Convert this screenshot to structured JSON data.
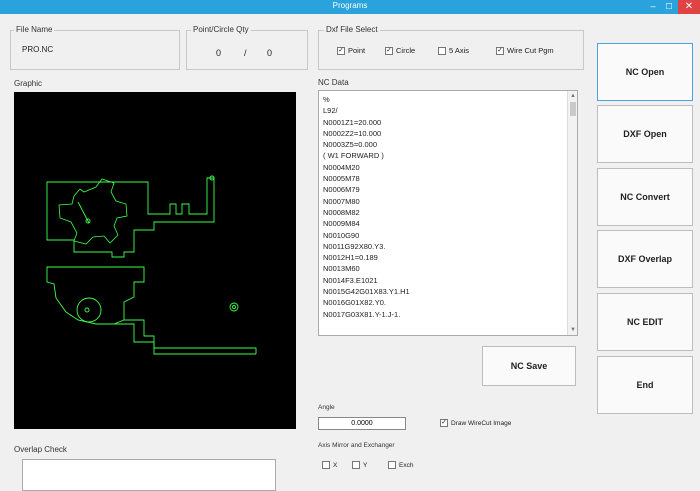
{
  "window": {
    "title": "Programs"
  },
  "file_name": {
    "label": "File Name",
    "value": "PRO.NC"
  },
  "point_circle": {
    "label": "Point/Circle Qty",
    "point": "0",
    "sep": "/",
    "circle": "0"
  },
  "dxf_select": {
    "label": "Dxf File Select",
    "options": [
      {
        "label": "Point",
        "checked": true
      },
      {
        "label": "Circle",
        "checked": true
      },
      {
        "label": "5 Axis",
        "checked": false
      },
      {
        "label": "Wire Cut Pgm",
        "checked": true
      }
    ]
  },
  "graphic": {
    "label": "Graphic"
  },
  "nc_data": {
    "label": "NC Data",
    "lines": [
      "%",
      "L92/",
      "N0001Z1=20.000",
      "N0002Z2=10.000",
      "N0003Z5=0.000",
      "( W1 FORWARD )",
      "N0004M20",
      "N0005M78",
      "N0006M79",
      "N0007M80",
      "N0008M82",
      "N0009M84",
      "N0010G90",
      "N0011G92X80.Y3.",
      "N0012H1=0.189",
      "N0013M60",
      "N0014F3.E1021",
      "N0015G42G01X83.Y1.H1",
      "N0016G01X82.Y0.",
      "N0017G03X81.Y-1.J-1."
    ]
  },
  "buttons": {
    "nc_open": "NC Open",
    "dxf_open": "DXF Open",
    "nc_convert": "NC Convert",
    "dxf_overlap": "DXF Overlap",
    "nc_edit": "NC EDIT",
    "end": "End",
    "nc_save": "NC Save"
  },
  "angle": {
    "label": "Angle",
    "value": "0.0000"
  },
  "draw_wirecut": {
    "label": "Draw WireCut Image",
    "checked": true
  },
  "axis_mirror": {
    "label": "Axis Mirror and Exchanger",
    "options": [
      {
        "label": "X",
        "checked": false
      },
      {
        "label": "Y",
        "checked": false
      },
      {
        "label": "Exch",
        "checked": false
      }
    ]
  },
  "overlap": {
    "label": "Overlap Check"
  },
  "colors": {
    "titlebar": "#2aa3dc",
    "close": "#e04343",
    "drawing": "#3cff4a",
    "canvas": "#000000"
  }
}
